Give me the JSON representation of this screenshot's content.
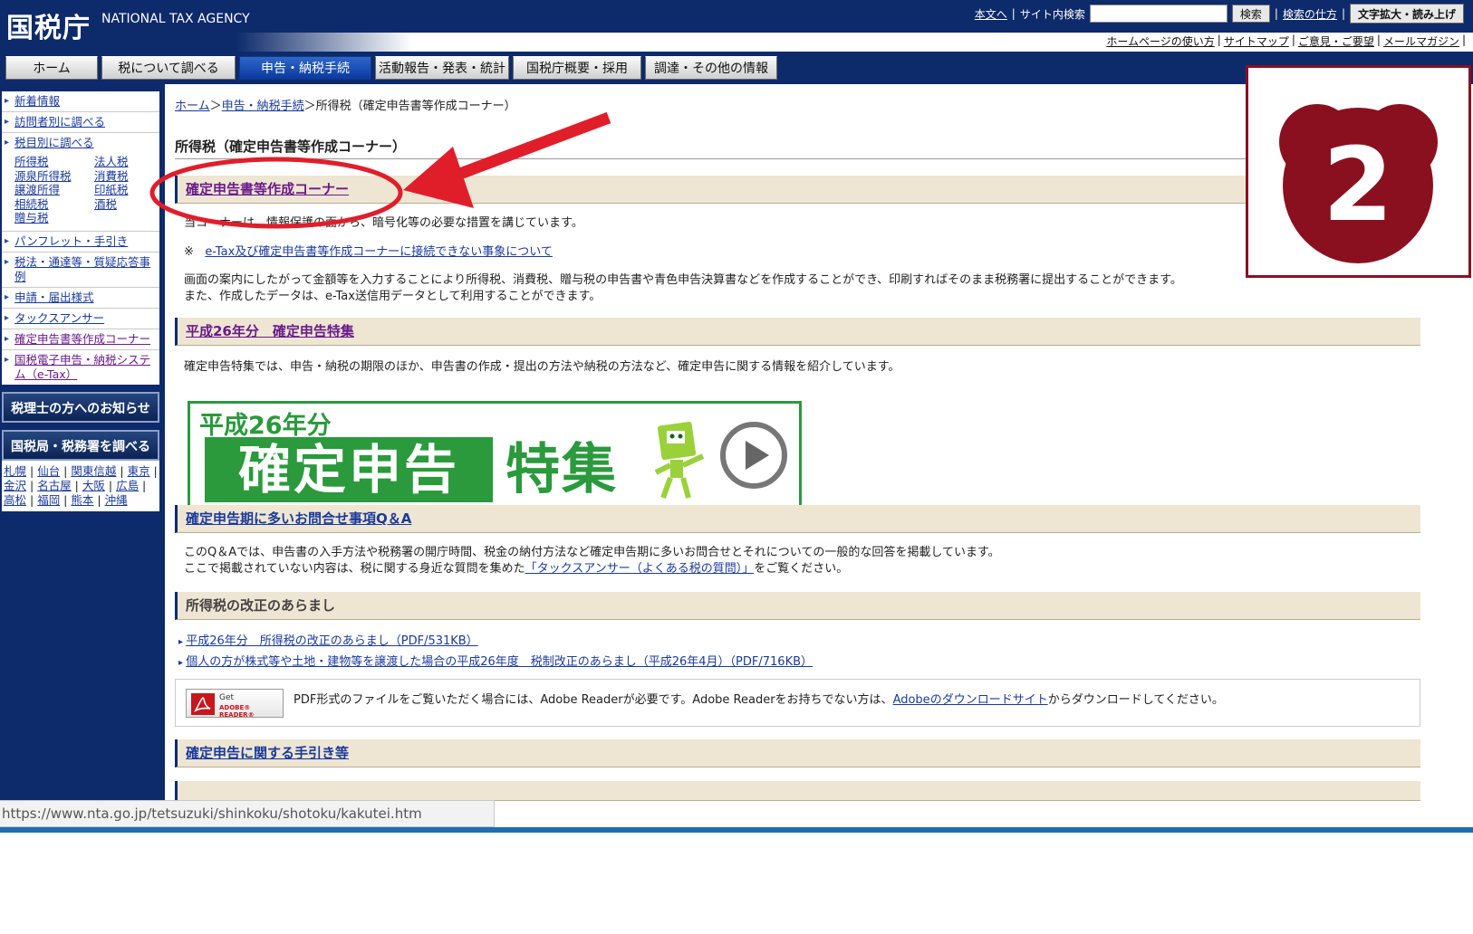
{
  "header": {
    "logo": "国税庁",
    "logo_en": "NATIONAL TAX AGENCY",
    "skip_link": "本文へ",
    "site_search_label": "サイト内検索",
    "search_placeholder": "",
    "search_button": "検索",
    "search_help": "検索の仕方",
    "zoom_button": "文字拡大・読み上げ",
    "sub_links": [
      "ホームページの使い方",
      "サイトマップ",
      "ご意見・ご要望",
      "メールマガジン"
    ]
  },
  "nav": {
    "tabs": [
      {
        "label": "ホーム"
      },
      {
        "label": "税について調べる"
      },
      {
        "label": "申告・納税手続",
        "active": true
      },
      {
        "label": "活動報告・発表・統計"
      },
      {
        "label": "国税庁概要・採用"
      },
      {
        "label": "調達・その他の情報"
      }
    ]
  },
  "sidebar": {
    "items_top": [
      "新着情報",
      "訪問者別に調べる",
      "税目別に調べる"
    ],
    "tax_grid": [
      [
        "所得税",
        "法人税"
      ],
      [
        "源泉所得税",
        "消費税"
      ],
      [
        "譲渡所得",
        "印紙税"
      ],
      [
        "相続税",
        "酒税"
      ],
      [
        "贈与税",
        ""
      ]
    ],
    "items_bottom": [
      "パンフレット・手引き",
      "税法・通達等・質疑応答事例",
      "申請・届出様式",
      "タックスアンサー",
      "確定申告書等作成コーナー",
      "国税電子申告・納税システム（e-Tax）"
    ],
    "tax_accountant_button": "税理士の方へのお知らせ",
    "bureau_button": "国税局・税務署を調べる",
    "cities": [
      "札幌",
      "仙台",
      "関東信越",
      "東京",
      "金沢",
      "名古屋",
      "大阪",
      "広島",
      "高松",
      "福岡",
      "熊本",
      "沖縄"
    ]
  },
  "main": {
    "breadcrumb": {
      "home": "ホーム",
      "sep": "＞",
      "section": "申告・納税手続",
      "current": "所得税（確定申告書等作成コーナー）"
    },
    "page_title": "所得税（確定申告書等作成コーナー）",
    "sec1": {
      "title": "確定申告書等作成コーナー",
      "p1": "当コーナーは、情報保護の面から、暗号化等の必要な措置を講じています。",
      "note_mark": "※",
      "note_link": "e-Tax及び確定申告書等作成コーナーに接続できない事象について",
      "p2_l1": "画面の案内にしたがって金額等を入力することにより所得税、消費税、贈与税の申告書や青色申告決算書などを作成することができ、印刷すればそのまま税務署に提出することができます。",
      "p2_l2": "また、作成したデータは、e-Tax送信用データとして利用することができます。"
    },
    "sec2": {
      "title": "平成26年分　確定申告特集",
      "p1": "確定申告特集では、申告・納税の期限のほか、申告書の作成・提出の方法や納税の方法など、確定申告に関する情報を紹介しています。",
      "banner_year": "平成26年分",
      "banner_main": "確定申告",
      "banner_special": "特集"
    },
    "sec3": {
      "title": "確定申告期に多いお問合せ事項Q＆A",
      "p1": "このQ＆Aでは、申告書の入手方法や税務署の開庁時間、税金の納付方法など確定申告期に多いお問合せとそれについての一般的な回答を掲載しています。",
      "p2_pre": "ここで掲載されていない内容は、税に関する身近な質問を集めた",
      "p2_link": "「タックスアンサー（よくある税の質問）」",
      "p2_post": "をご覧ください。"
    },
    "sec4": {
      "title": "所得税の改正のあらまし",
      "link1": "平成26年分　所得税の改正のあらまし（PDF/531KB）",
      "link2": "個人の方が株式等や土地・建物等を譲渡した場合の平成26年度　税制改正のあらまし（平成26年4月）（PDF/716KB）"
    },
    "adobe": {
      "badge_line1": "Get",
      "badge_line2": "ADOBE® READER®",
      "text_pre": "PDF形式のファイルをご覧いただく場合には、Adobe Readerが必要です。Adobe Readerをお持ちでない方は、",
      "text_link1": "Adobe",
      "text_link2": "のダウンロードサイト",
      "text_post": "からダウンロードしてください。"
    },
    "sec5": {
      "title": "確定申告に関する手引き等"
    }
  },
  "overlay": {
    "step_number": "2",
    "badge_color": "#8a1020",
    "annotation_color": "#e01e2a"
  },
  "statusbar": {
    "url": "https://www.nta.go.jp/tetsuzuki/shinkoku/shotoku/kakutei.htm"
  }
}
